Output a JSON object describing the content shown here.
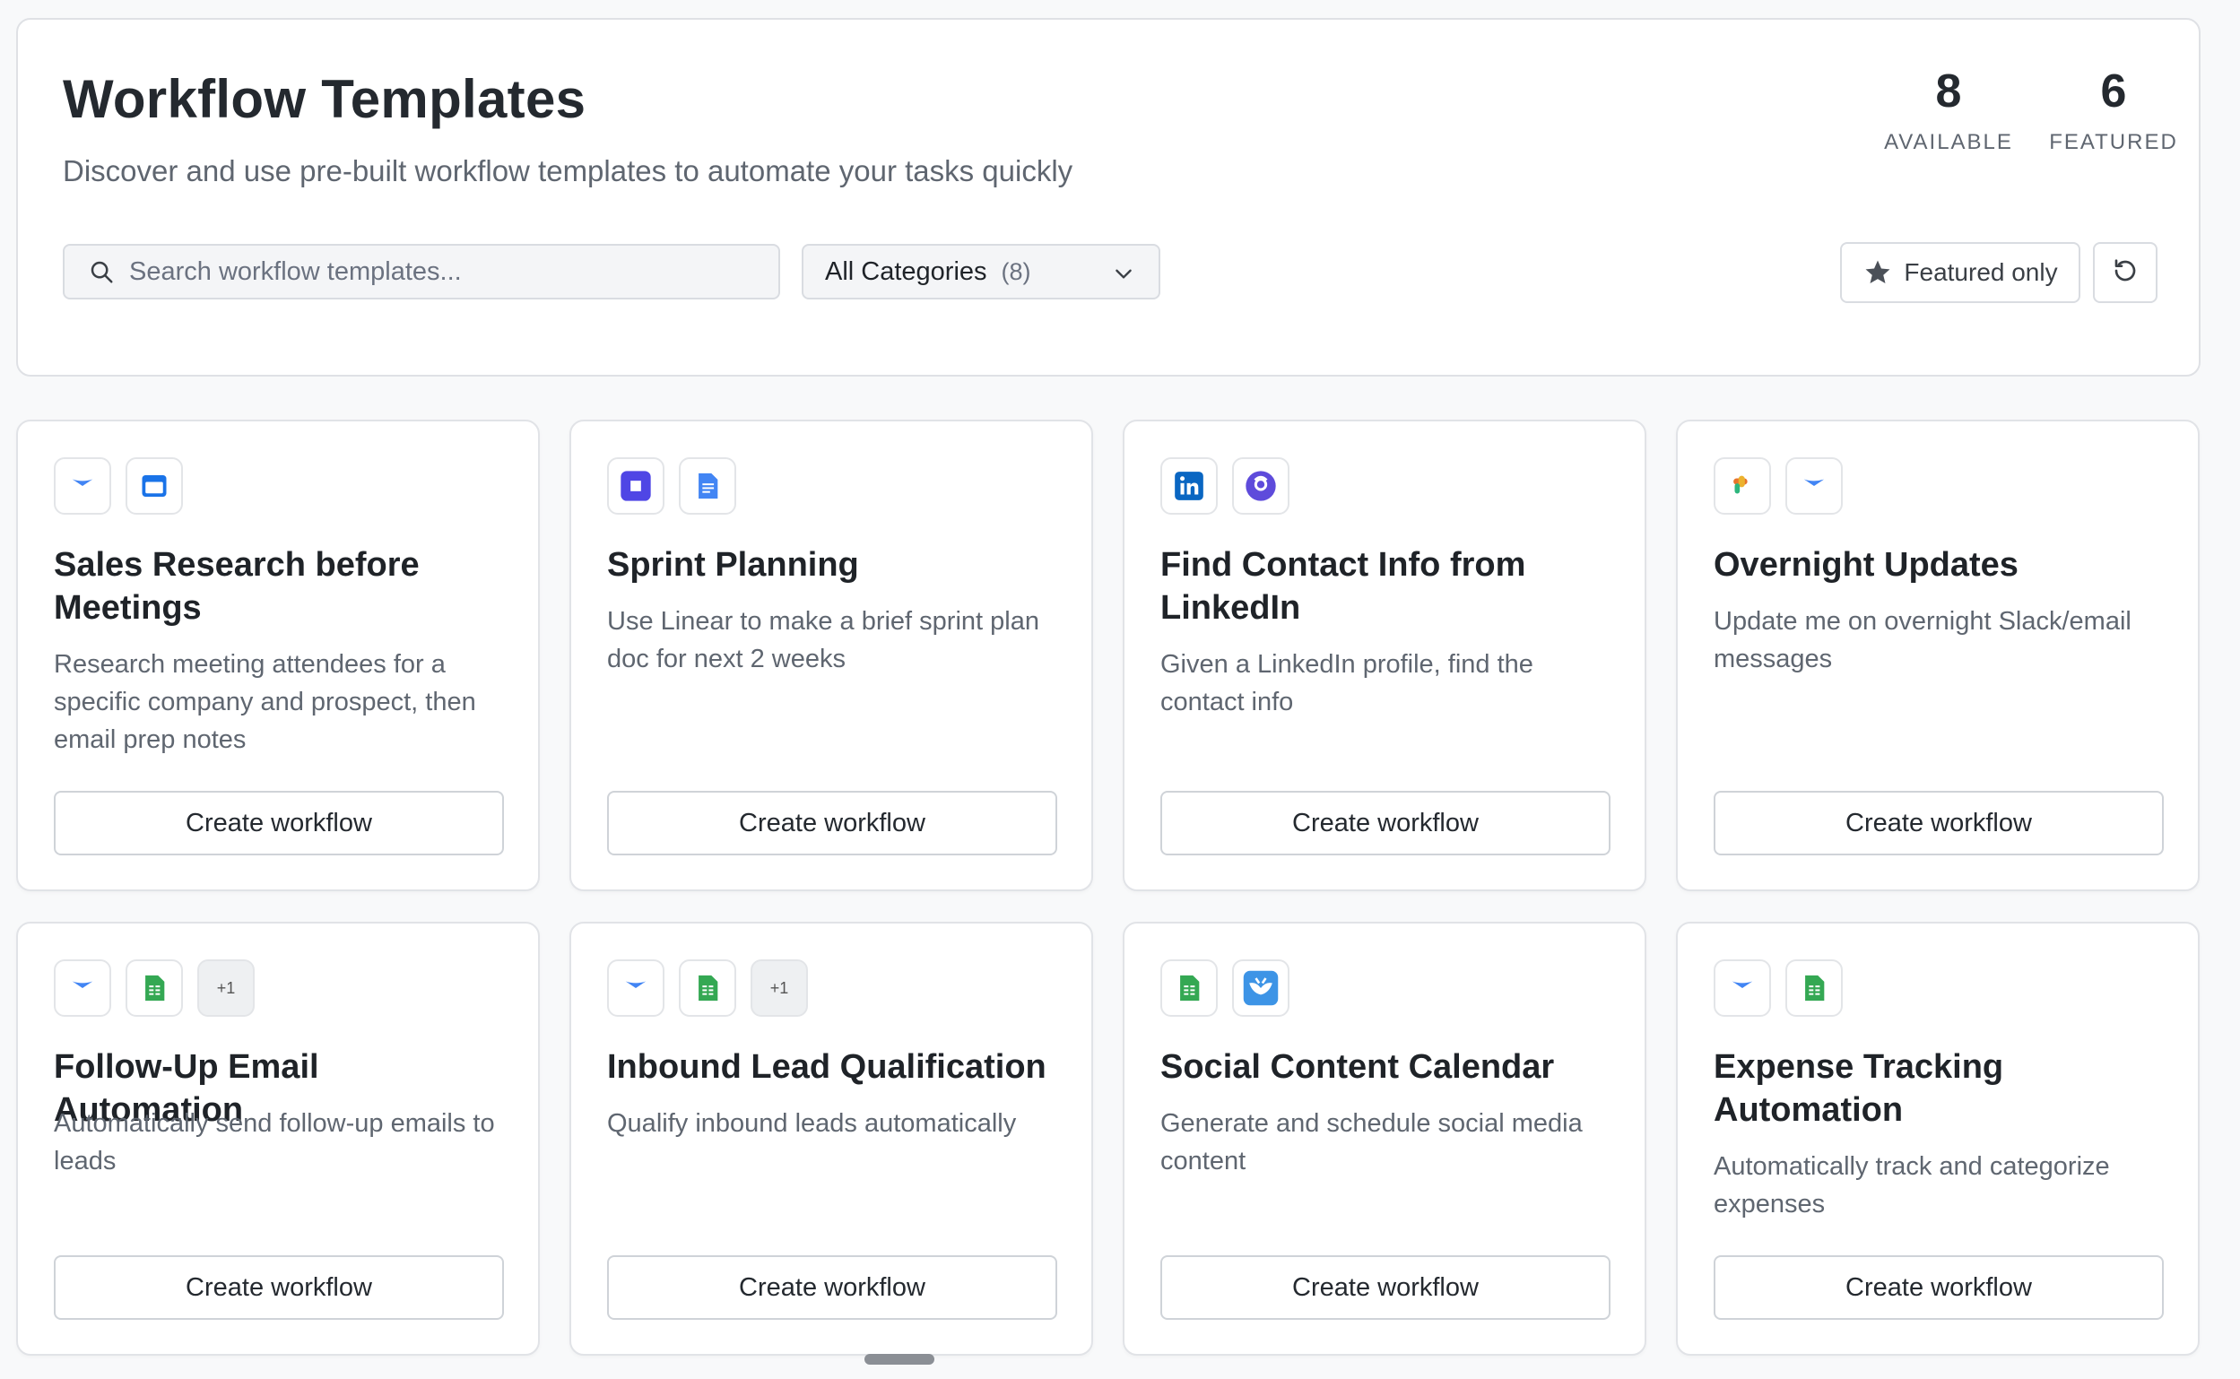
{
  "header": {
    "title": "Workflow Templates",
    "subtitle": "Discover and use pre-built workflow templates to automate your tasks quickly",
    "stats": {
      "available_value": "8",
      "available_label": "AVAILABLE",
      "featured_value": "6",
      "featured_label": "FEATURED"
    }
  },
  "search": {
    "placeholder": "Search workflow templates...",
    "icon": "search-icon"
  },
  "category_filter": {
    "selected": "All Categories",
    "count": "(8)",
    "icon": "chevron-down-icon"
  },
  "featured_toggle": {
    "label": "Featured only",
    "icon": "star-icon"
  },
  "reset_button": {
    "icon": "refresh-icon"
  },
  "colors": {
    "gmail_blue": "#4285f4",
    "sheets_green": "#34a853",
    "linear_purple": "#5e5ce6",
    "linkedin_blue": "#0a66c2"
  },
  "templates": [
    {
      "title": "Sales Research before Meetings",
      "description": "Research meeting attendees for a specific company and prospect, then email prep notes",
      "icons": [
        "gmail-icon",
        "calendar-icon"
      ],
      "button": "Create workflow"
    },
    {
      "title": "Sprint Planning",
      "description": "Use Linear to make a brief sprint plan doc for next 2 weeks",
      "icons": [
        "linear-icon",
        "google-docs-icon"
      ],
      "button": "Create workflow"
    },
    {
      "title": "Find Contact Info from LinkedIn",
      "description": "Given a LinkedIn profile, find the contact info",
      "icons": [
        "linkedin-icon",
        "search-app-icon"
      ],
      "button": "Create workflow"
    },
    {
      "title": "Overnight Updates",
      "description": "Update me on overnight Slack/email messages",
      "icons": [
        "slack-icon",
        "gmail-icon"
      ],
      "button": "Create workflow"
    },
    {
      "title": "Follow-Up Email Automation",
      "description": "Automatically send follow-up emails to leads",
      "icons": [
        "gmail-icon",
        "google-sheets-icon"
      ],
      "more": "+1",
      "button": "Create workflow"
    },
    {
      "title": "Inbound Lead Qualification",
      "description": "Qualify inbound leads automatically",
      "icons": [
        "gmail-icon",
        "google-sheets-icon"
      ],
      "more": "+1",
      "button": "Create workflow"
    },
    {
      "title": "Social Content Calendar",
      "description": "Generate and schedule social media content",
      "icons": [
        "google-sheets-icon",
        "bluesky-icon"
      ],
      "button": "Create workflow"
    },
    {
      "title": "Expense Tracking Automation",
      "description": "Automatically track and categorize expenses",
      "icons": [
        "gmail-icon",
        "google-sheets-icon"
      ],
      "button": "Create workflow"
    }
  ]
}
